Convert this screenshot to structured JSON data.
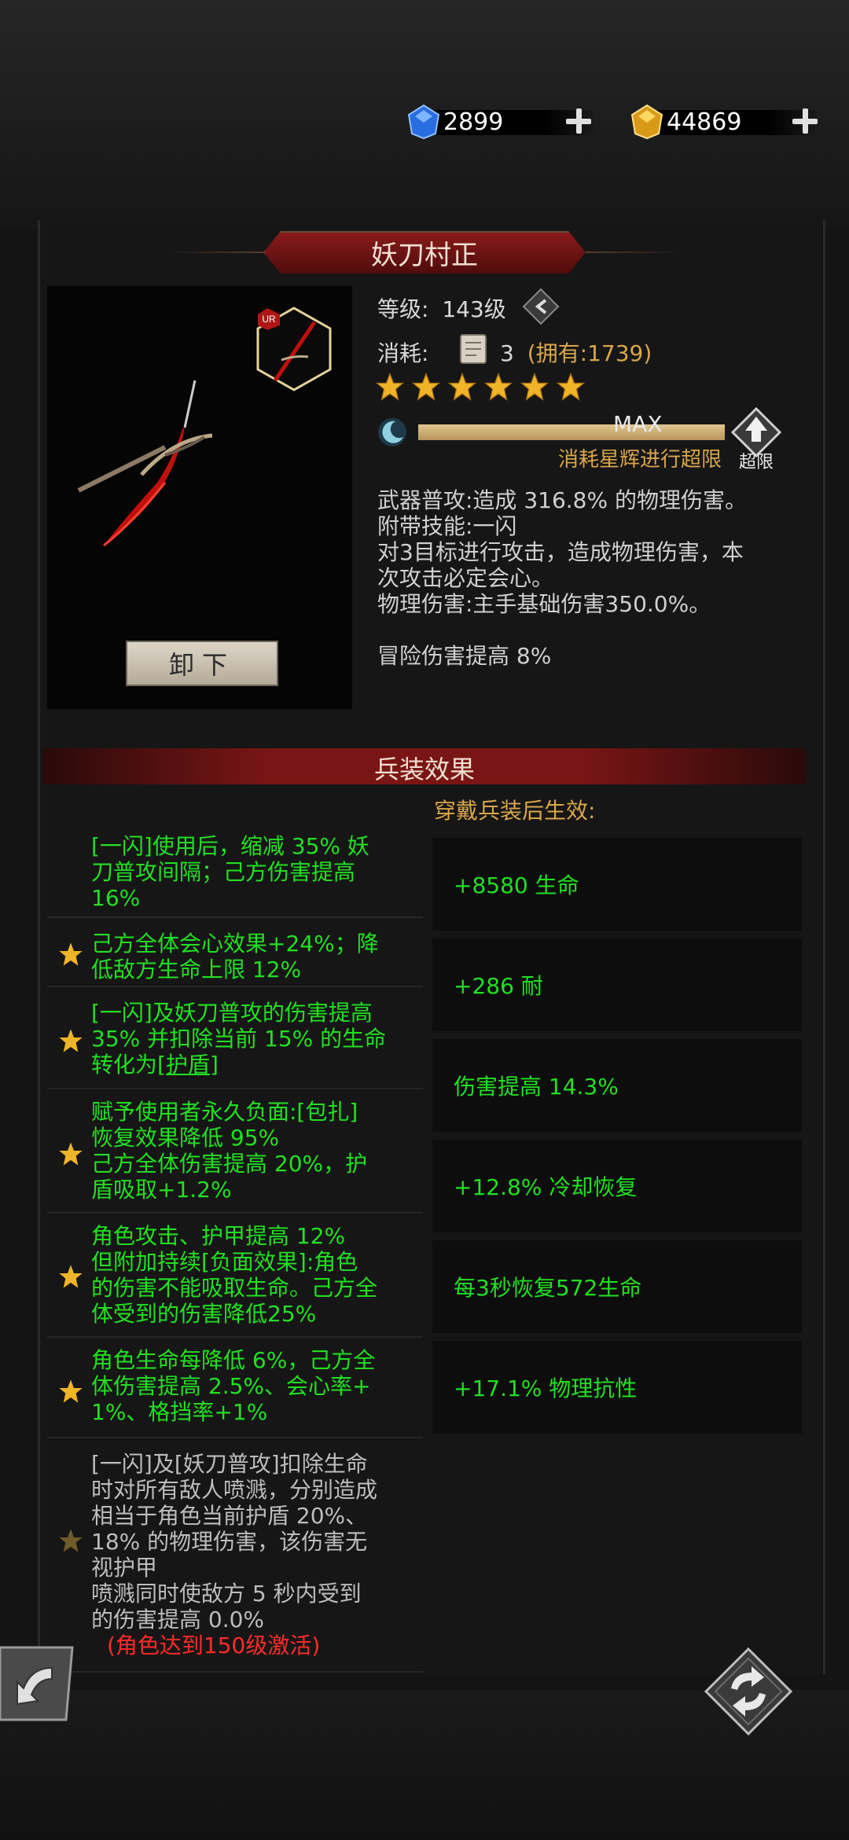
{
  "currency": {
    "gems": "2899",
    "gold": "44869"
  },
  "weapon": {
    "name": "妖刀村正",
    "rarity": "UR",
    "level_label": "等级:",
    "level_value": "143级",
    "cost_label": "消耗:",
    "cost_count": "3",
    "cost_owned": "(拥有:1739)",
    "stars": 6,
    "max_label": "MAX",
    "limit_hint": "消耗星辉进行超限",
    "limit_label": "超限",
    "unequip_label": "卸下",
    "desc_lines": [
      "武器普攻:造成 316.8% 的物理伤害。",
      "附带技能:一闪",
      "对3目标进行攻击，造成物理伤害，本",
      "次攻击必定会心。",
      "物理伤害:主手基础伤害350.0%。"
    ],
    "adventure_bonus": "冒险伤害提高 8%"
  },
  "effects": {
    "title": "兵装效果",
    "subtitle": "穿戴兵装后生效:",
    "bonuses": [
      "+8580 生命",
      "+286 耐",
      "伤害提高 14.3%",
      "+12.8% 冷却恢复",
      "每3秒恢复572生命",
      "+17.1% 物理抗性"
    ],
    "rows": [
      {
        "star": false,
        "lines": [
          "[一闪]使用后，缩减 35% 妖",
          "刀普攻间隔；己方伤害提高",
          "16%"
        ]
      },
      {
        "star": true,
        "lines": [
          "己方全体会心效果+24%；降",
          "低敌方生命上限 12%"
        ]
      },
      {
        "star": true,
        "lines": [
          "[一闪]及妖刀普攻的伤害提高",
          "35% 并扣除当前 15% 的生命",
          "转化为"
        ],
        "link": "[护盾]"
      },
      {
        "star": true,
        "lines": [
          "赋予使用者永久负面:[包扎]",
          "恢复效果降低 95%",
          "己方全体伤害提高 20%，护",
          "盾吸取+1.2%"
        ]
      },
      {
        "star": true,
        "lines": [
          "角色攻击、护甲提高 12%",
          "但附加持续[负面效果]:角色",
          "的伤害不能吸取生命。己方全",
          "体受到的伤害降低25%"
        ]
      },
      {
        "star": true,
        "lines": [
          "角色生命每降低 6%，己方全",
          "体伤害提高 2.5%、会心率+",
          "1%、格挡率+1%"
        ]
      },
      {
        "star": true,
        "locked": true,
        "lines": [
          "[一闪]及[妖刀普攻]扣除生命",
          "时对所有敌人喷溅，分别造成",
          "相当于角色当前护盾 20%、",
          "18% 的物理伤害，该伤害无",
          "视护甲",
          "喷溅同时使敌方 5 秒内受到",
          "的伤害提高 0.0%"
        ],
        "requirement": "(角色达到150级激活)"
      }
    ]
  }
}
